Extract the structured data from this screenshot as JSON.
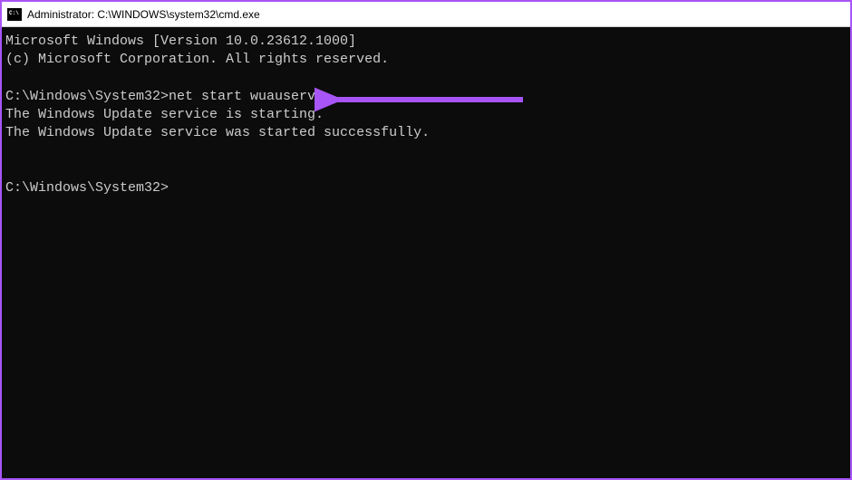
{
  "window": {
    "title": "Administrator: C:\\WINDOWS\\system32\\cmd.exe"
  },
  "terminal": {
    "header_line1": "Microsoft Windows [Version 10.0.23612.1000]",
    "header_line2": "(c) Microsoft Corporation. All rights reserved.",
    "prompt1_path": "C:\\Windows\\System32>",
    "prompt1_command": "net start wuauserv",
    "output_line1": "The Windows Update service is starting.",
    "output_line2": "The Windows Update service was started successfully.",
    "prompt2_path": "C:\\Windows\\System32>"
  },
  "annotations": {
    "arrow_color": "#a855f7"
  }
}
